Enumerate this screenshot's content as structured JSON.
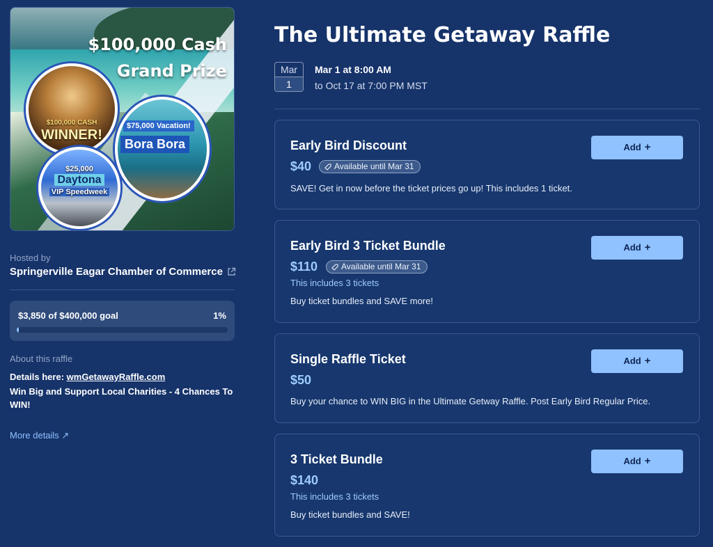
{
  "promo": {
    "headline_line1": "$100,000 Cash",
    "headline_line2": "Grand Prize",
    "winner_amount": "$100,000 CASH",
    "winner_word": "WINNER!",
    "bora_tag": "$75,000 Vacation!",
    "bora_place": "Bora Bora",
    "daytona_amount": "$25,000",
    "daytona_name": "Daytona",
    "daytona_sub": "VIP Speedweek"
  },
  "host": {
    "label": "Hosted by",
    "name": "Springerville Eagar Chamber of Commerce"
  },
  "goal": {
    "text": "$3,850 of $400,000 goal",
    "percent_label": "1%",
    "progress": 0.01
  },
  "about": {
    "label": "About this raffle",
    "details_prefix": "Details here: ",
    "details_link": "wmGetawayRaffle.com",
    "description": "Win Big and Support Local Charities - 4 Chances To WIN!",
    "more_details": "More details ↗"
  },
  "event": {
    "title": "The Ultimate Getaway Raffle",
    "month": "Mar",
    "day": "1",
    "start": "Mar 1 at 8:00 AM",
    "end": "to Oct 17 at 7:00 PM MST"
  },
  "tickets": [
    {
      "name": "Early Bird Discount",
      "price": "$40",
      "badge": "Available until Mar 31",
      "includes": "",
      "description": "SAVE! Get in now before the ticket prices go up! This includes 1 ticket.",
      "button": "Add"
    },
    {
      "name": "Early Bird 3 Ticket Bundle",
      "price": "$110",
      "badge": "Available until Mar 31",
      "includes": "This includes 3 tickets",
      "description": "Buy ticket bundles and SAVE more!",
      "button": "Add"
    },
    {
      "name": "Single Raffle Ticket",
      "price": "$50",
      "badge": "",
      "includes": "",
      "description": "Buy your chance to WIN BIG in the Ultimate Getway Raffle. Post Early Bird Regular Price.",
      "button": "Add"
    },
    {
      "name": "3 Ticket Bundle",
      "price": "$140",
      "badge": "",
      "includes": "This includes 3 tickets",
      "description": "Buy ticket bundles and SAVE!",
      "button": "Add"
    }
  ],
  "colors": {
    "background": "#16336a",
    "card": "#17376e",
    "accent": "#8fc2ff",
    "goal_card": "#2f4b7c"
  }
}
